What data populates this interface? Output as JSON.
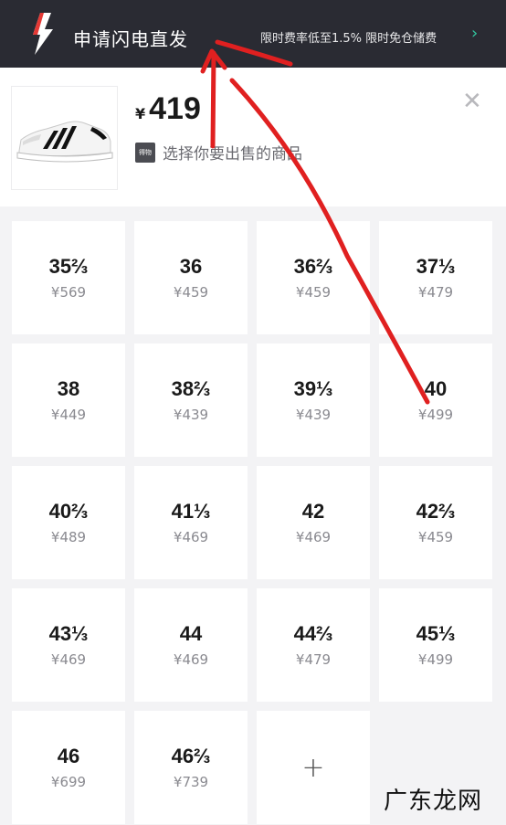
{
  "banner": {
    "title": "申请闪电直发",
    "promo": "限时费率低至1.5% 限时免仓储费",
    "chevron_icon": "chevron-right-icon",
    "bolt_icon": "lightning-bolt-icon",
    "accent": "#32c7a0"
  },
  "product": {
    "currency": "¥",
    "price": "419",
    "hint": "选择你要出售的商品",
    "badge": "得物",
    "close_icon": "close-icon"
  },
  "sizes": [
    {
      "size": "35⅔",
      "price": "¥569"
    },
    {
      "size": "36",
      "price": "¥459"
    },
    {
      "size": "36⅔",
      "price": "¥459"
    },
    {
      "size": "37⅓",
      "price": "¥479"
    },
    {
      "size": "38",
      "price": "¥449"
    },
    {
      "size": "38⅔",
      "price": "¥439"
    },
    {
      "size": "39⅓",
      "price": "¥439"
    },
    {
      "size": "40",
      "price": "¥499"
    },
    {
      "size": "40⅔",
      "price": "¥489"
    },
    {
      "size": "41⅓",
      "price": "¥469"
    },
    {
      "size": "42",
      "price": "¥469"
    },
    {
      "size": "42⅔",
      "price": "¥459"
    },
    {
      "size": "43⅓",
      "price": "¥469"
    },
    {
      "size": "44",
      "price": "¥469"
    },
    {
      "size": "44⅔",
      "price": "¥479"
    },
    {
      "size": "45⅓",
      "price": "¥499"
    },
    {
      "size": "46",
      "price": "¥699"
    },
    {
      "size": "46⅔",
      "price": "¥739"
    }
  ],
  "add_cell": {
    "label": "+"
  },
  "watermark": "广东龙网"
}
